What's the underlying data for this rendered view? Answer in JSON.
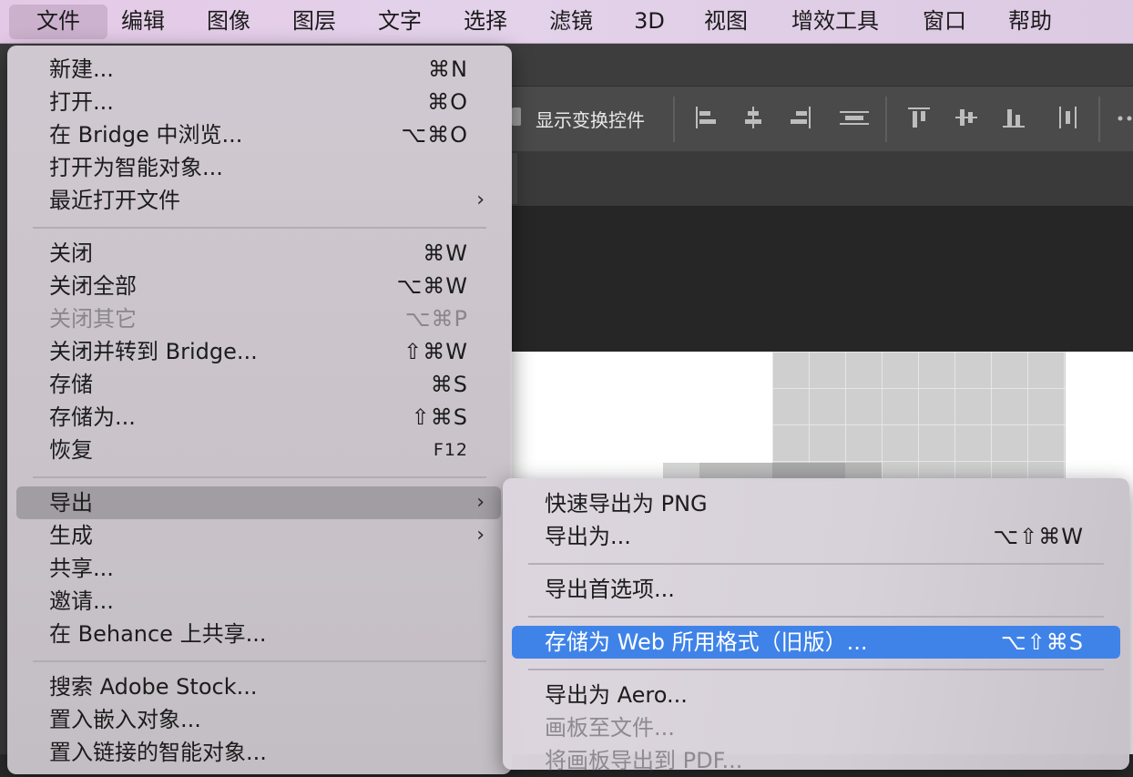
{
  "menubar": {
    "items": [
      {
        "label": "文件",
        "active": true
      },
      {
        "label": "编辑"
      },
      {
        "label": "图像"
      },
      {
        "label": "图层"
      },
      {
        "label": "文字"
      },
      {
        "label": "选择"
      },
      {
        "label": "滤镜"
      },
      {
        "label": "3D"
      },
      {
        "label": "视图"
      },
      {
        "label": "增效工具"
      },
      {
        "label": "窗口"
      },
      {
        "label": "帮助"
      }
    ]
  },
  "options_bar": {
    "show_transform_label": "显示变换控件",
    "icons": [
      "align-left-edges-icon",
      "align-horizontal-centers-icon",
      "align-right-edges-icon",
      "align-vertical-distribute-icon",
      "align-top-edges-icon",
      "align-vertical-centers-icon",
      "align-bottom-edges-icon",
      "distribute-horizontal-icon",
      "more-icon"
    ]
  },
  "file_menu": {
    "items": [
      {
        "label": "新建...",
        "shortcut": "⌘N"
      },
      {
        "label": "打开...",
        "shortcut": "⌘O"
      },
      {
        "label": "在 Bridge 中浏览...",
        "shortcut": "⌥⌘O"
      },
      {
        "label": "打开为智能对象...",
        "shortcut": ""
      },
      {
        "label": "最近打开文件",
        "shortcut": "",
        "submenu": true
      },
      {
        "label": "关闭",
        "shortcut": "⌘W"
      },
      {
        "label": "关闭全部",
        "shortcut": "⌥⌘W"
      },
      {
        "label": "关闭其它",
        "shortcut": "⌥⌘P",
        "disabled": true
      },
      {
        "label": "关闭并转到 Bridge...",
        "shortcut": "⇧⌘W"
      },
      {
        "label": "存储",
        "shortcut": "⌘S"
      },
      {
        "label": "存储为...",
        "shortcut": "⇧⌘S"
      },
      {
        "label": "恢复",
        "shortcut": "F12"
      },
      {
        "label": "导出",
        "shortcut": "",
        "submenu": true,
        "highlighted": true
      },
      {
        "label": "生成",
        "shortcut": "",
        "submenu": true
      },
      {
        "label": "共享...",
        "shortcut": ""
      },
      {
        "label": "邀请...",
        "shortcut": ""
      },
      {
        "label": "在 Behance 上共享...",
        "shortcut": ""
      },
      {
        "label": "搜索 Adobe Stock...",
        "shortcut": ""
      },
      {
        "label": "置入嵌入对象...",
        "shortcut": ""
      },
      {
        "label": "置入链接的智能对象...",
        "shortcut": ""
      }
    ]
  },
  "export_submenu": {
    "items": [
      {
        "label": "快速导出为 PNG",
        "shortcut": ""
      },
      {
        "label": "导出为...",
        "shortcut": "⌥⇧⌘W"
      },
      {
        "label": "导出首选项...",
        "shortcut": ""
      },
      {
        "label": "存储为 Web 所用格式（旧版）...",
        "shortcut": "⌥⇧⌘S",
        "highlighted": true
      },
      {
        "label": "导出为 Aero...",
        "shortcut": ""
      },
      {
        "label": "画板至文件...",
        "shortcut": "",
        "disabled": true
      },
      {
        "label": "将画板导出到 PDF...",
        "shortcut": "",
        "disabled": true
      }
    ]
  }
}
